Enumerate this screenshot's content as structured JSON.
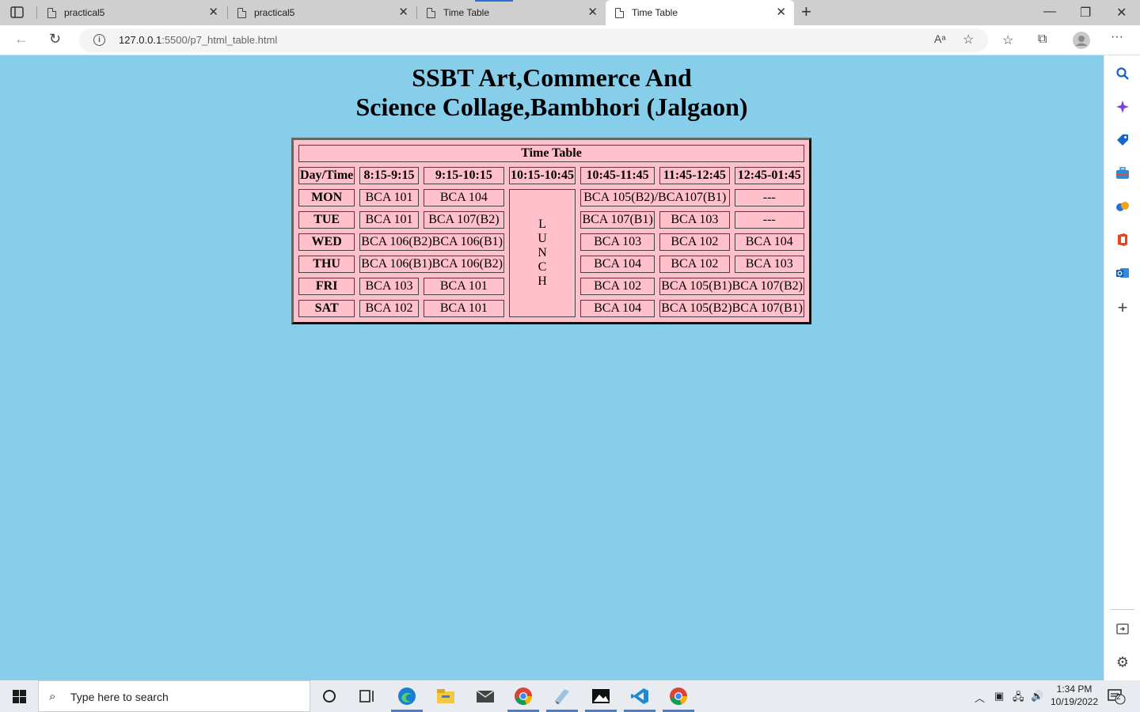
{
  "browser": {
    "tabs": [
      {
        "label": "practical5"
      },
      {
        "label": "practical5"
      },
      {
        "label": "Time Table"
      },
      {
        "label": "Time Table",
        "active": true
      }
    ],
    "url_host": "127.0.0.1",
    "url_rest": ":5500/p7_html_table.html"
  },
  "page": {
    "heading_line1": "SSBT Art,Commerce And",
    "heading_line2": "Science Collage,Bambhori (Jalgaon)",
    "background": "#87ceeb"
  },
  "timetable": {
    "caption": "Time Table",
    "background": "#ffc0cb",
    "header": [
      "Day/Time",
      "8:15-9:15",
      "9:15-10:15",
      "10:15-10:45",
      "10:45-11:45",
      "11:45-12:45",
      "12:45-01:45"
    ],
    "lunch_letters": [
      "L",
      "U",
      "N",
      "C",
      "H"
    ],
    "rows": {
      "mon": {
        "day": "MON",
        "c1": "BCA 101",
        "c2": "BCA 104",
        "c45": "BCA 105(B2)/BCA107(B1)",
        "c6": "---"
      },
      "tue": {
        "day": "TUE",
        "c1": "BCA 101",
        "c2": "BCA 107(B2)",
        "c4": "BCA 107(B1)",
        "c5": "BCA 103",
        "c6": "---"
      },
      "wed": {
        "day": "WED",
        "c12": "BCA 106(B2)BCA 106(B1)",
        "c4": "BCA 103",
        "c5": "BCA 102",
        "c6": "BCA 104"
      },
      "thu": {
        "day": "THU",
        "c12": "BCA 106(B1)BCA 106(B2)",
        "c4": "BCA 104",
        "c5": "BCA 102",
        "c6": "BCA 103"
      },
      "fri": {
        "day": "FRI",
        "c1": "BCA 103",
        "c2": "BCA 101",
        "c4": "BCA 102",
        "c56": "BCA 105(B1)BCA 107(B2)"
      },
      "sat": {
        "day": "SAT",
        "c1": "BCA 102",
        "c2": "BCA 101",
        "c4": "BCA 104",
        "c56": "BCA 105(B2)BCA 107(B1)"
      }
    }
  },
  "taskbar": {
    "search_placeholder": "Type here to search",
    "time": "1:34 PM",
    "date": "10/19/2022",
    "notification_count": "2"
  },
  "icons": {
    "tab_actions": "tab-actions-icon",
    "page_tab": "document-icon",
    "sidebar": [
      "search-icon",
      "sparkle-icon",
      "shopping-tag-icon",
      "toolbox-icon",
      "games-icon",
      "office-icon",
      "outlook-icon",
      "plus-icon"
    ]
  }
}
